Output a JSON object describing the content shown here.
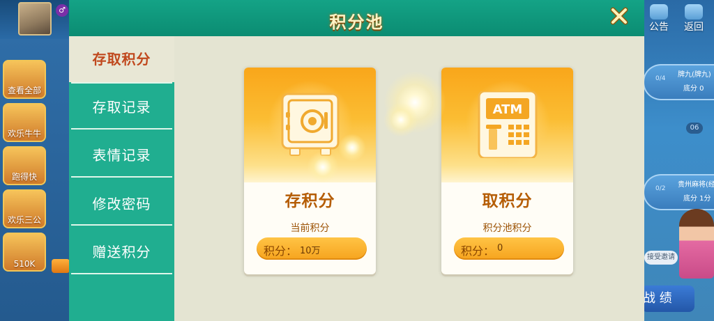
{
  "modal": {
    "title": "积分池",
    "tabs": [
      {
        "label": "存取积分",
        "active": true
      },
      {
        "label": "存取记录",
        "active": false
      },
      {
        "label": "表情记录",
        "active": false
      },
      {
        "label": "修改密码",
        "active": false
      },
      {
        "label": "赠送积分",
        "active": false
      }
    ],
    "cards": [
      {
        "title": "存积分",
        "sub_label": "当前积分",
        "pill_label": "积分：",
        "pill_value": "10万",
        "icon": "safe-icon"
      },
      {
        "title": "取积分",
        "sub_label": "积分池积分",
        "pill_label": "积分：",
        "pill_value": "0",
        "icon": "atm-icon"
      }
    ],
    "atm_text": "ATM"
  },
  "background": {
    "game_tiles": [
      "查看全部",
      "欢乐牛牛",
      "跑得快",
      "欢乐三公",
      "510K"
    ],
    "notice_label": "公告",
    "back_label": "返回",
    "rooms": [
      {
        "title": "牌九(牌九)",
        "count": "0/4",
        "score": "底分 0"
      },
      {
        "title": "贵州麻将(经典)",
        "count": "0/2",
        "score": "底分 1分"
      }
    ],
    "table_number": "06",
    "accept_invite_label": "接受邀请",
    "record_label": "战 绩"
  },
  "colors": {
    "header_green": "#0b8c72",
    "sidebar_green": "#20ae90",
    "active_tab_text": "#c0481d",
    "card_orange": "#f9a61a",
    "title_gold": "#fff3c4"
  }
}
